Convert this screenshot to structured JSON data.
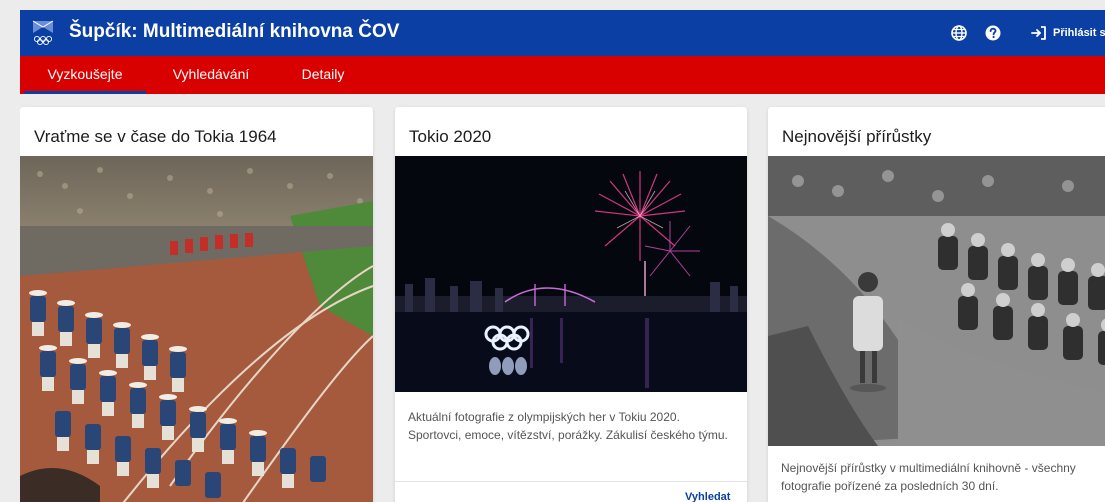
{
  "header": {
    "title": "Šupčík: Multimediální knihovna ČOV",
    "icons": [
      "globe-icon",
      "help-icon",
      "login-icon"
    ],
    "login_label": "Přihlásit se"
  },
  "tabs": [
    {
      "label": "Vyzkoušejte",
      "active": true
    },
    {
      "label": "Vyhledávání",
      "active": false
    },
    {
      "label": "Detaily",
      "active": false
    }
  ],
  "cards": [
    {
      "title": "Vraťme se v čase do Tokia 1964",
      "image": "photo-tokyo-1964-parade"
    },
    {
      "title": "Tokio 2020",
      "image": "photo-tokyo-2020-fireworks",
      "description": "Aktuální fotografie z olympijských her v Tokiu 2020. Sportovci, emoce, vítězství, porážky. Zákulisí českého týmu.",
      "link": "Vyhledat"
    },
    {
      "title": "Nejnovější přírůstky",
      "image": "photo-newest-additions",
      "description": "Nejnovější přírůstky v multimediální knihovně - všechny fotografie pořízené za posledních 30 dní."
    }
  ],
  "colors": {
    "header": "#0b3fa4",
    "tabs": "#d90000",
    "link": "#0b3fa4"
  }
}
